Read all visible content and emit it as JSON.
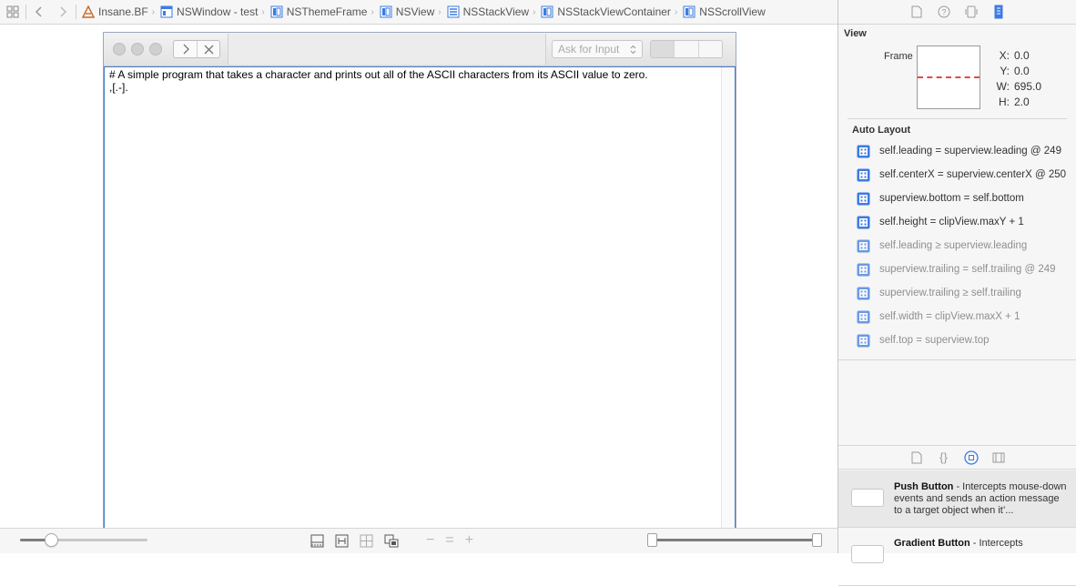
{
  "jumpbar": {
    "crumbs": [
      {
        "label": "Insane.BF",
        "icon": "app-icon"
      },
      {
        "label": "NSWindow - test",
        "icon": "window-icon"
      },
      {
        "label": "NSThemeFrame",
        "icon": "view-icon"
      },
      {
        "label": "NSView",
        "icon": "view-icon"
      },
      {
        "label": "NSStackView",
        "icon": "stackview-icon"
      },
      {
        "label": "NSStackViewContainer",
        "icon": "view-icon"
      },
      {
        "label": "NSScrollView",
        "icon": "view-icon"
      }
    ]
  },
  "window": {
    "input_placeholder": "Ask for Input",
    "text_line_1": "# A simple program that takes a character and prints out all of the ASCII characters from its ASCII value to zero.",
    "text_line_2": ",[.-]."
  },
  "inspector": {
    "section_view": "View",
    "frame_label": "Frame",
    "frame": {
      "x_label": "X:",
      "x": "0.0",
      "y_label": "Y:",
      "y": "0.0",
      "w_label": "W:",
      "w": "695.0",
      "h_label": "H:",
      "h": "2.0"
    },
    "section_autolayout": "Auto Layout",
    "constraints": [
      {
        "text": "self.leading = superview.leading @ 249",
        "active": true
      },
      {
        "text": "self.centerX = superview.centerX @ 250",
        "active": true
      },
      {
        "text": "superview.bottom = self.bottom",
        "active": true
      },
      {
        "text": "self.height = clipView.maxY + 1",
        "active": true
      },
      {
        "text": "self.leading ≥ superview.leading",
        "active": false
      },
      {
        "text": "superview.trailing = self.trailing @ 249",
        "active": false
      },
      {
        "text": "superview.trailing ≥ self.trailing",
        "active": false
      },
      {
        "text": "self.width = clipView.maxX + 1",
        "active": false
      },
      {
        "text": "self.top = superview.top",
        "active": false
      }
    ]
  },
  "library": {
    "items": [
      {
        "name": "Push Button",
        "desc": " - Intercepts mouse-down events and sends an action message to a target object when it’..."
      },
      {
        "name": "Gradient Button",
        "desc": " - Intercepts"
      }
    ]
  },
  "zoom": {
    "level": 0.24
  },
  "range": {
    "start": 0.0,
    "end": 1.0
  },
  "colors": {
    "accent": "#3d7be0",
    "selection_border": "#4a7cc7",
    "frame_line": "#e24a4a"
  }
}
